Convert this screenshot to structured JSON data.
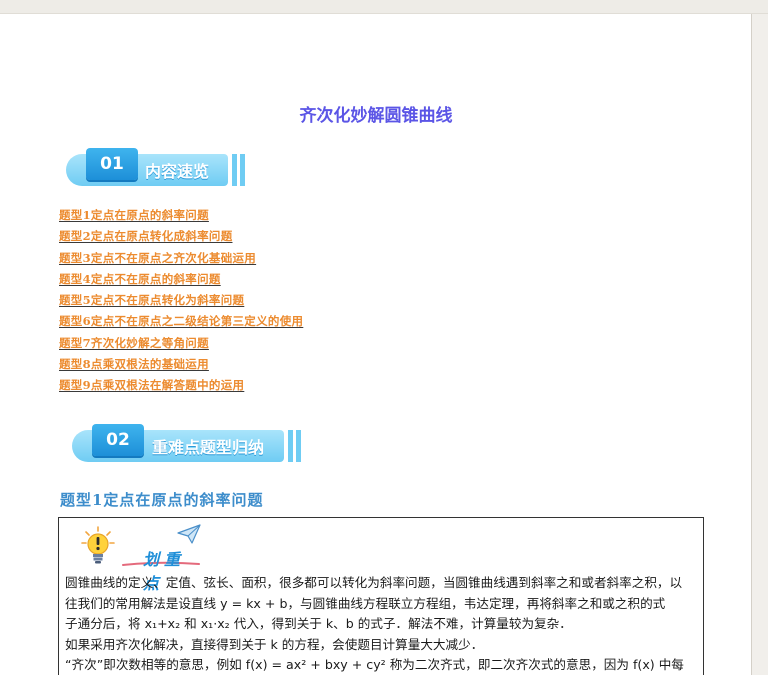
{
  "document": {
    "title": "齐次化妙解圆锥曲线"
  },
  "section1": {
    "number": "01",
    "label": "内容速览",
    "toc": [
      "题型1定点在原点的斜率问题",
      "题型2定点在原点转化成斜率问题",
      "题型3定点不在原点之齐次化基础运用",
      "题型4定点不在原点的斜率问题",
      "题型5定点不在原点转化为斜率问题",
      "题型6定点不在原点之二级结论第三定义的使用",
      "题型7齐次化妙解之等角问题",
      "题型8点乘双根法的基础运用",
      "题型9点乘双根法在解答题中的运用"
    ]
  },
  "section2": {
    "number": "02",
    "label": "重难点题型归纳",
    "heading": "题型1定点在原点的斜率问题"
  },
  "focus": {
    "title": "划重点",
    "lines": [
      "圆锥曲线的定义、定值、弦长、面积，很多都可以转化为斜率问题，当圆锥曲线遇到斜率之和或者斜率之积，以",
      "往我们的常用解法是设直线 y = kx + b，与圆锥曲线方程联立方程组，韦达定理，再将斜率之和或之积的式",
      "子通分后，将 x₁+x₂ 和 x₁·x₂ 代入，得到关于 k、b 的式子．解法不难，计算量较为复杂．",
      "如果采用齐次化解决，直接得到关于 k 的方程，会使题目计算量大大减少．",
      "“齐次”即次数相等的意思，例如 f(x) = ax² + bxy + cy² 称为二次齐式，即二次齐次式的意思，因为 f(x) 中每"
    ]
  },
  "colors": {
    "title": "#5b55e6",
    "toc": "#ec8b2f",
    "heading": "#3d8dcb",
    "banner_tab": "#1d8fd8",
    "banner_bar": "#6fccf3"
  }
}
